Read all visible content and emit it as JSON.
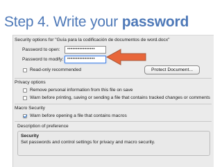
{
  "slide": {
    "title_prefix": "Step 4. Write your ",
    "title_bold": "password"
  },
  "dialog": {
    "security_options_label": "Security options for \"Guía para la codificación de documentos de word.docx\"",
    "password_open_label": "Password to open:",
    "password_open_value": "••••••••••••••••",
    "password_modify_label": "Password to modify:",
    "password_modify_value": "••••••••••••••••",
    "read_only_label": "Read-only recommended",
    "protect_document_label": "Protect Document...",
    "privacy_heading": "Privacy options",
    "remove_personal_label": "Remove personal information from this file on save",
    "warn_tracked_label": "Warn before printing, saving or sending a file that contains tracked changes or comments",
    "macro_heading": "Macro Security",
    "warn_macros_label": "Warn before opening a file that contains macros",
    "description_heading": "Description of preference",
    "description_title": "Security",
    "description_text": "Set passwords and control settings for privacy and macro security."
  },
  "colors": {
    "title": "#4e79b8",
    "arrow": "#e8663a",
    "highlight": "#4a86e8"
  }
}
